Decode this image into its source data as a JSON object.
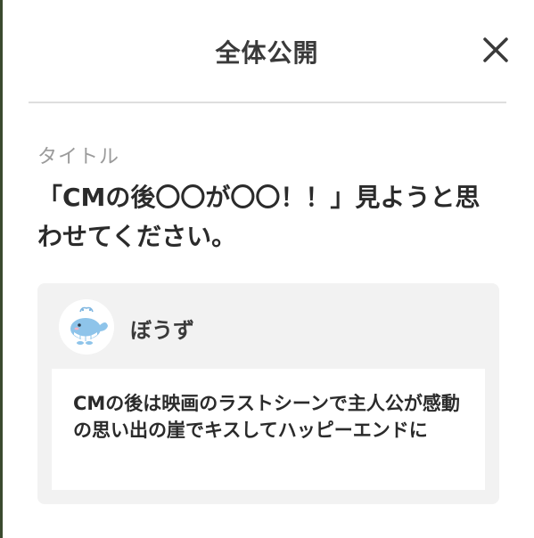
{
  "header": {
    "title": "全体公開",
    "close_icon": "close-icon"
  },
  "post": {
    "section_label": "タイトル",
    "title": "「CMの後〇〇が〇〇！！」見ようと思わせてください。"
  },
  "comment": {
    "avatar_icon": "whale-avatar",
    "username": "ぼうず",
    "text": "CMの後は映画のラストシーンで主人公が感動の思い出の崖でキスしてハッピーエンドに"
  },
  "colors": {
    "background": "#ffffff",
    "card": "#f2f2f2",
    "text": "#2b2b2b",
    "muted": "#9b9b9b",
    "divider": "#dedede"
  }
}
